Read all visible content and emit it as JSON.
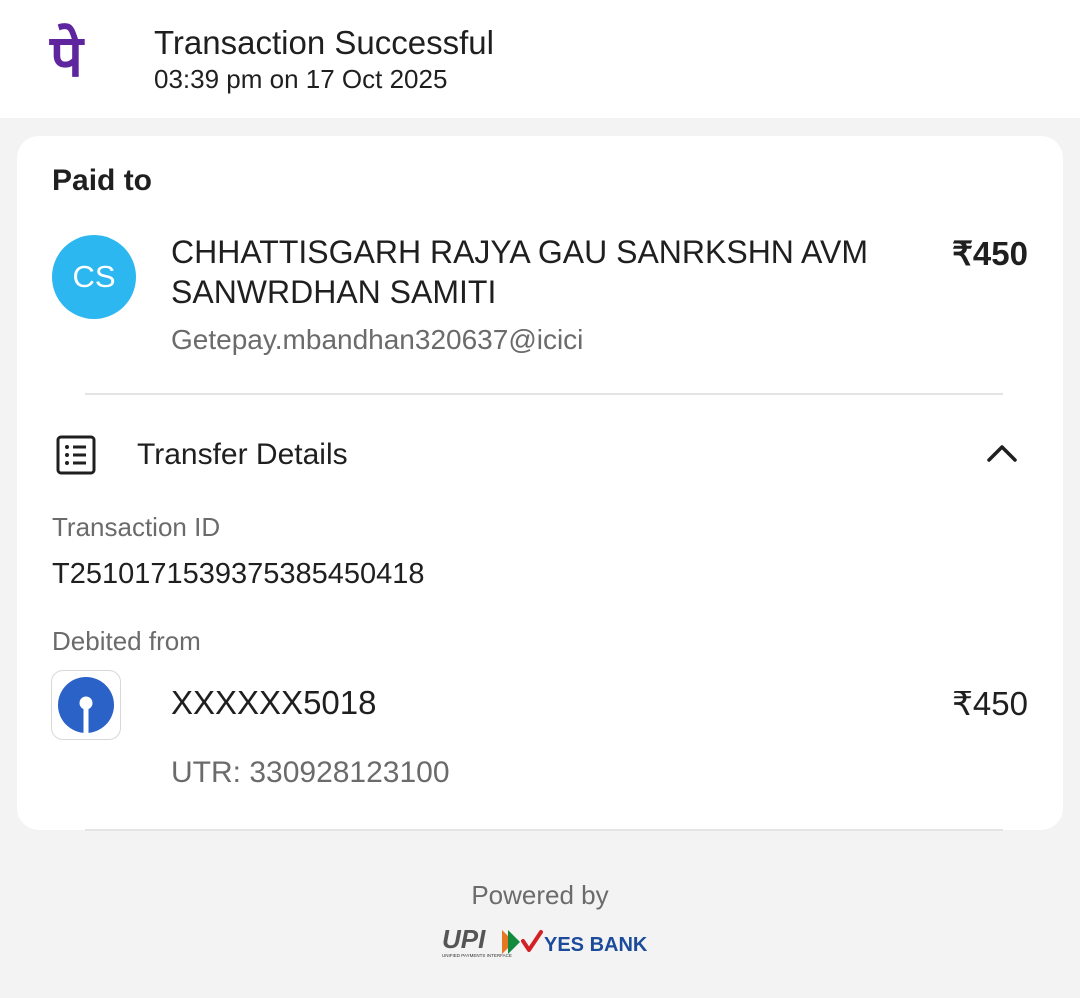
{
  "header": {
    "logo_glyph": "पे",
    "title": "Transaction Successful",
    "timestamp": "03:39 pm on 17 Oct 2025",
    "brand_color": "#5f259f"
  },
  "payee": {
    "section_label": "Paid to",
    "avatar_initials": "CS",
    "avatar_color": "#2db7f0",
    "name": "CHHATTISGARH RAJYA GAU SANRKSHN AVM SANWRDHAN SAMITI",
    "amount": "₹450",
    "vpa": "Getepay.mbandhan320637@icici"
  },
  "transfer": {
    "label": "Transfer Details",
    "icon": "receipt-list-icon",
    "toggle_icon": "chevron-up-icon",
    "txn_id_label": "Transaction ID",
    "txn_id": "T2510171539375385450418",
    "debited_label": "Debited from",
    "account": "XXXXXX5018",
    "debit_amount": "₹450",
    "utr": "UTR: 330928123100"
  },
  "footer": {
    "powered_by": "Powered by",
    "upi_text": "UPI",
    "upi_tagline": "UNIFIED PAYMENTS INTERFACE",
    "yes_bank": "YES BANK"
  }
}
